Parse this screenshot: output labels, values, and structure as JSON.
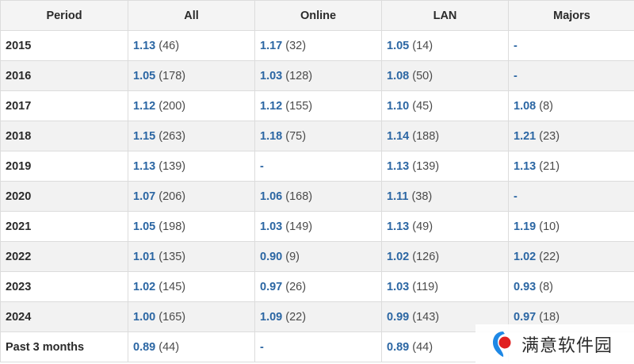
{
  "table": {
    "headers": [
      "Period",
      "All",
      "Online",
      "LAN",
      "Majors"
    ],
    "rows": [
      {
        "period": "2015",
        "cells": [
          {
            "rating": "1.13",
            "count": "(46)"
          },
          {
            "rating": "1.17",
            "count": "(32)"
          },
          {
            "rating": "1.05",
            "count": "(14)"
          },
          {
            "rating": "-",
            "count": ""
          }
        ]
      },
      {
        "period": "2016",
        "cells": [
          {
            "rating": "1.05",
            "count": "(178)"
          },
          {
            "rating": "1.03",
            "count": "(128)"
          },
          {
            "rating": "1.08",
            "count": "(50)"
          },
          {
            "rating": "-",
            "count": ""
          }
        ]
      },
      {
        "period": "2017",
        "cells": [
          {
            "rating": "1.12",
            "count": "(200)"
          },
          {
            "rating": "1.12",
            "count": "(155)"
          },
          {
            "rating": "1.10",
            "count": "(45)"
          },
          {
            "rating": "1.08",
            "count": "(8)"
          }
        ]
      },
      {
        "period": "2018",
        "cells": [
          {
            "rating": "1.15",
            "count": "(263)"
          },
          {
            "rating": "1.18",
            "count": "(75)"
          },
          {
            "rating": "1.14",
            "count": "(188)"
          },
          {
            "rating": "1.21",
            "count": "(23)"
          }
        ]
      },
      {
        "period": "2019",
        "cells": [
          {
            "rating": "1.13",
            "count": "(139)"
          },
          {
            "rating": "-",
            "count": ""
          },
          {
            "rating": "1.13",
            "count": "(139)"
          },
          {
            "rating": "1.13",
            "count": "(21)"
          }
        ]
      },
      {
        "period": "2020",
        "cells": [
          {
            "rating": "1.07",
            "count": "(206)"
          },
          {
            "rating": "1.06",
            "count": "(168)"
          },
          {
            "rating": "1.11",
            "count": "(38)"
          },
          {
            "rating": "-",
            "count": ""
          }
        ]
      },
      {
        "period": "2021",
        "cells": [
          {
            "rating": "1.05",
            "count": "(198)"
          },
          {
            "rating": "1.03",
            "count": "(149)"
          },
          {
            "rating": "1.13",
            "count": "(49)"
          },
          {
            "rating": "1.19",
            "count": "(10)"
          }
        ]
      },
      {
        "period": "2022",
        "cells": [
          {
            "rating": "1.01",
            "count": "(135)"
          },
          {
            "rating": "0.90",
            "count": "(9)"
          },
          {
            "rating": "1.02",
            "count": "(126)"
          },
          {
            "rating": "1.02",
            "count": "(22)"
          }
        ]
      },
      {
        "period": "2023",
        "cells": [
          {
            "rating": "1.02",
            "count": "(145)"
          },
          {
            "rating": "0.97",
            "count": "(26)"
          },
          {
            "rating": "1.03",
            "count": "(119)"
          },
          {
            "rating": "0.93",
            "count": "(8)"
          }
        ]
      },
      {
        "period": "2024",
        "cells": [
          {
            "rating": "1.00",
            "count": "(165)"
          },
          {
            "rating": "1.09",
            "count": "(22)"
          },
          {
            "rating": "0.99",
            "count": "(143)"
          },
          {
            "rating": "0.97",
            "count": "(18)"
          }
        ]
      },
      {
        "period": "Past 3 months",
        "cells": [
          {
            "rating": "0.89",
            "count": "(44)"
          },
          {
            "rating": "-",
            "count": ""
          },
          {
            "rating": "0.89",
            "count": "(44)"
          },
          {
            "rating": "",
            "count": ""
          }
        ]
      }
    ]
  },
  "watermark": {
    "text": "满意软件园",
    "icon": "watermark-logo-icon"
  },
  "colors": {
    "rating": "#2b66a3",
    "header_bg": "#f4f4f4",
    "stripe_bg": "#f2f2f2",
    "border": "#dcdcdc",
    "logo_red": "#e02020",
    "logo_blue": "#1e88e5"
  }
}
